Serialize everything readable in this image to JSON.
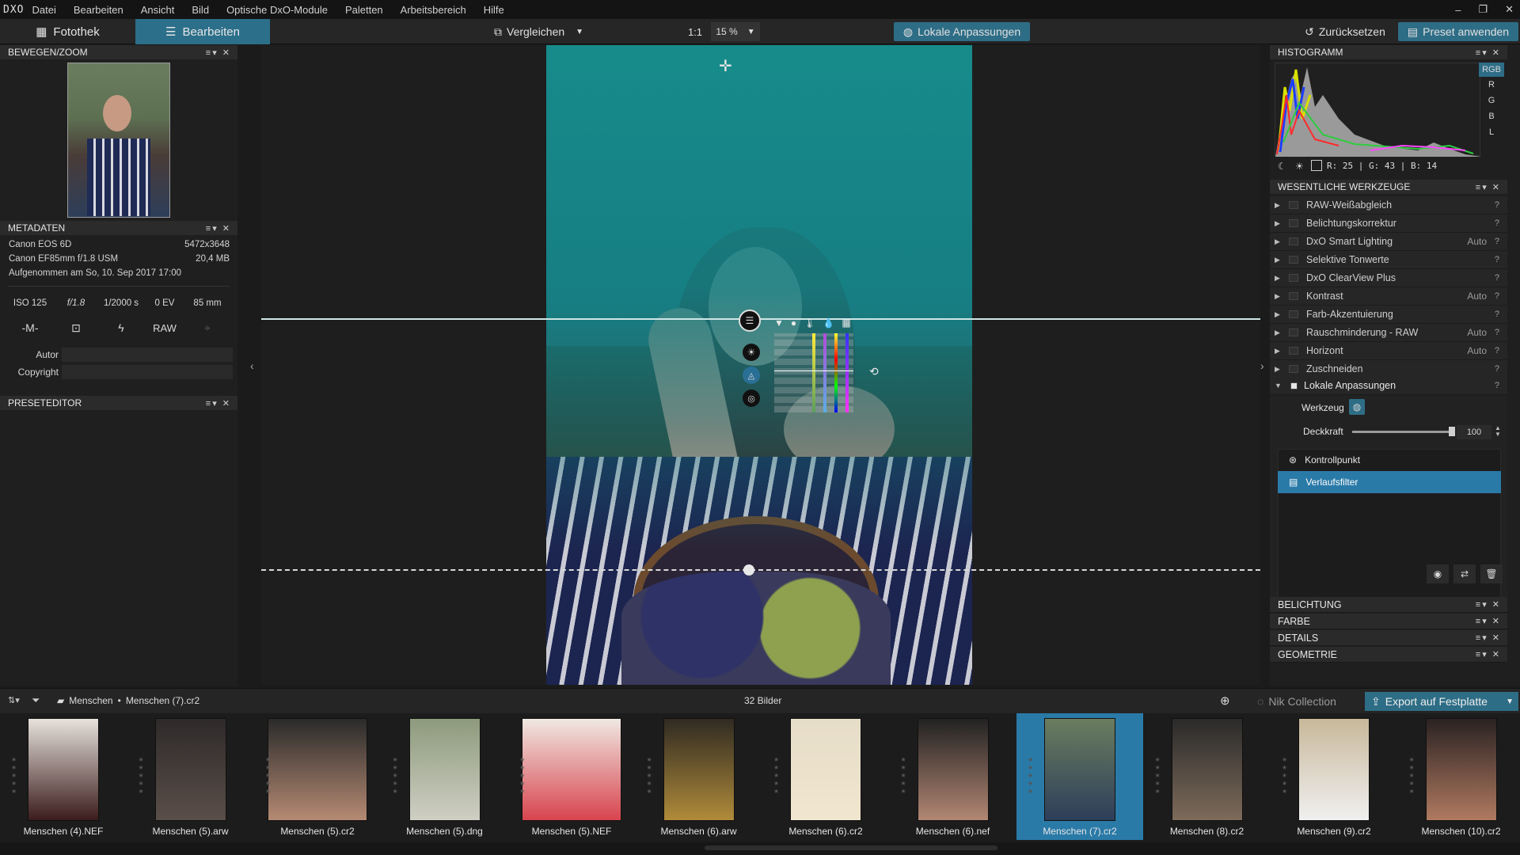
{
  "app": {
    "logo": "DXO"
  },
  "menu": [
    "Datei",
    "Bearbeiten",
    "Ansicht",
    "Bild",
    "Optische DxO-Module",
    "Paletten",
    "Arbeitsbereich",
    "Hilfe"
  ],
  "toolbar": {
    "tab_fotothek": "Fotothek",
    "tab_bearbeiten": "Bearbeiten",
    "compare": "Vergleichen",
    "one_to_one": "1:1",
    "zoom": "15 %",
    "local_adjust": "Lokale Anpassungen",
    "reset": "Zurücksetzen",
    "apply_preset": "Preset anwenden"
  },
  "left": {
    "move_zoom_title": "BEWEGEN/ZOOM",
    "metadata_title": "METADATEN",
    "camera": "Canon EOS 6D",
    "dimensions": "5472x3648",
    "lens": "Canon EF85mm f/1.8 USM",
    "filesize": "20,4 MB",
    "taken": "Aufgenommen am So, 10. Sep 2017 17:00",
    "exif": {
      "iso": "ISO 125",
      "aperture": "f/1.8",
      "shutter": "1/2000 s",
      "ev": "0 EV",
      "focal": "85 mm"
    },
    "mode": "-M-",
    "raw": "RAW",
    "author_label": "Autor",
    "copyright_label": "Copyright",
    "preset_editor_title": "PRESETEDITOR"
  },
  "right": {
    "histogram_title": "HISTOGRAMM",
    "hist_channels": [
      "RGB",
      "R",
      "G",
      "B",
      "L"
    ],
    "hist_readout": "R: 25 | G: 43 | B: 14",
    "essentials_title": "WESENTLICHE WERKZEUGE",
    "tools": [
      {
        "label": "RAW-Weißabgleich",
        "auto": ""
      },
      {
        "label": "Belichtungskorrektur",
        "auto": ""
      },
      {
        "label": "DxO Smart Lighting",
        "auto": "Auto"
      },
      {
        "label": "Selektive Tonwerte",
        "auto": ""
      },
      {
        "label": "DxO ClearView Plus",
        "auto": ""
      },
      {
        "label": "Kontrast",
        "auto": "Auto"
      },
      {
        "label": "Farb-Akzentuierung",
        "auto": ""
      },
      {
        "label": "Rauschminderung - RAW",
        "auto": "Auto"
      },
      {
        "label": "Horizont",
        "auto": "Auto"
      },
      {
        "label": "Zuschneiden",
        "auto": ""
      }
    ],
    "local_adj_label": "Lokale Anpassungen",
    "tool_label": "Werkzeug",
    "opacity_label": "Deckkraft",
    "opacity_value": "100",
    "opacity_level": 1.0,
    "masks": [
      "Kontrollpunkt",
      "Verlaufsfilter"
    ],
    "sections": [
      "BELICHTUNG",
      "FARBE",
      "DETAILS",
      "GEOMETRIE"
    ]
  },
  "filmbar": {
    "breadcrumb_folder": "Menschen",
    "breadcrumb_file": "Menschen (7).cr2",
    "count": "32 Bilder",
    "nik": "Nik Collection",
    "export": "Export auf Festplatte"
  },
  "thumbnails": [
    "Menschen (4).NEF",
    "Menschen (5).arw",
    "Menschen (5).cr2",
    "Menschen (5).dng",
    "Menschen (5).NEF",
    "Menschen (6).arw",
    "Menschen (6).cr2",
    "Menschen (6).nef",
    "Menschen (7).cr2",
    "Menschen (8).cr2",
    "Menschen (9).cr2",
    "Menschen (10).cr2"
  ],
  "colors": {
    "accent": "#2e6d86",
    "selected": "#2a7aa8",
    "bg": "#1f1f1f"
  }
}
